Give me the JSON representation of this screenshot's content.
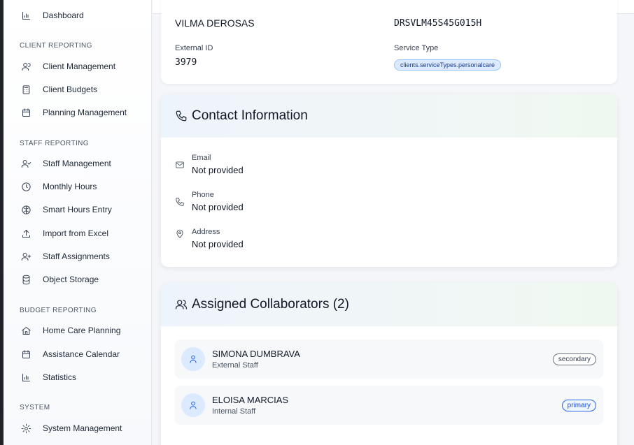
{
  "sidebar": {
    "dashboard": "Dashboard",
    "sections": {
      "client": "CLIENT REPORTING",
      "staff": "STAFF REPORTING",
      "budget": "BUDGET REPORTING",
      "system": "SYSTEM"
    },
    "items": {
      "client_management": "Client Management",
      "client_budgets": "Client Budgets",
      "planning_management": "Planning Management",
      "staff_management": "Staff Management",
      "monthly_hours": "Monthly Hours",
      "smart_hours_entry": "Smart Hours Entry",
      "import_from_excel": "Import from Excel",
      "staff_assignments": "Staff Assignments",
      "object_storage": "Object Storage",
      "home_care_planning": "Home Care Planning",
      "assistance_calendar": "Assistance Calendar",
      "statistics": "Statistics",
      "system_management": "System Management"
    }
  },
  "client": {
    "name": "VILMA DEROSAS",
    "fiscal_code": "DRSVLM45S45G015H",
    "external_id_label": "External ID",
    "external_id": "3979",
    "service_type_label": "Service Type",
    "service_type": "clients.serviceTypes.personalcare"
  },
  "contact": {
    "title": "Contact Information",
    "email_label": "Email",
    "email_value": "Not provided",
    "phone_label": "Phone",
    "phone_value": "Not provided",
    "address_label": "Address",
    "address_value": "Not provided"
  },
  "collaborators": {
    "title": "Assigned Collaborators (2)",
    "items": [
      {
        "name": "SIMONA DUMBRAVA",
        "type": "External Staff",
        "role": "secondary"
      },
      {
        "name": "ELOISA MARCIAS",
        "type": "Internal Staff",
        "role": "primary"
      }
    ]
  }
}
